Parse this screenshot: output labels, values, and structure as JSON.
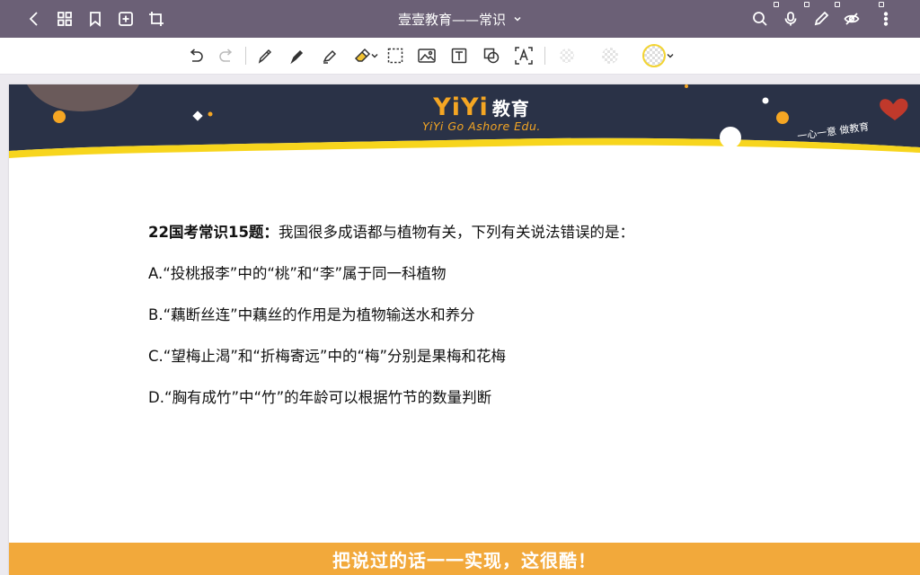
{
  "appbar": {
    "title": "壹壹教育——常识",
    "icons": [
      "back-icon",
      "grid-icon",
      "bookmark-icon",
      "add-page-icon",
      "crop-icon",
      "search-icon",
      "mic-icon",
      "pen-icon",
      "eye-off-icon",
      "more-icon"
    ]
  },
  "toolbar": {
    "tools": [
      "undo",
      "redo",
      "pen",
      "pen-fill",
      "highlighter",
      "eraser",
      "lasso-select",
      "image",
      "text",
      "shape",
      "text-recognition",
      "color-swatch-1",
      "color-swatch-2",
      "color-picker"
    ]
  },
  "banner": {
    "logo": "YiYi",
    "logo_cn": "教育",
    "subtitle": "YiYi Go Ashore Edu.",
    "slogan": "一心一意 做教育",
    "colors": {
      "navy": "#2a3247",
      "yellow": "#f7d51d",
      "orange": "#f5a623"
    }
  },
  "question": {
    "prefix": "22国考常识15题：",
    "stem": "我国很多成语都与植物有关，下列有关说法错误的是：",
    "options": [
      "A.“投桃报李”中的“桃”和“李”属于同一科植物",
      "B.“藕断丝连”中藕丝的作用是为植物输送水和养分",
      "C.“望梅止渴”和“折梅寄远”中的“梅”分别是果梅和花梅",
      "D.“胸有成竹”中“竹”的年龄可以根据竹节的数量判断"
    ]
  },
  "footer": {
    "text": "把说过的话一一实现，这很酷！"
  }
}
